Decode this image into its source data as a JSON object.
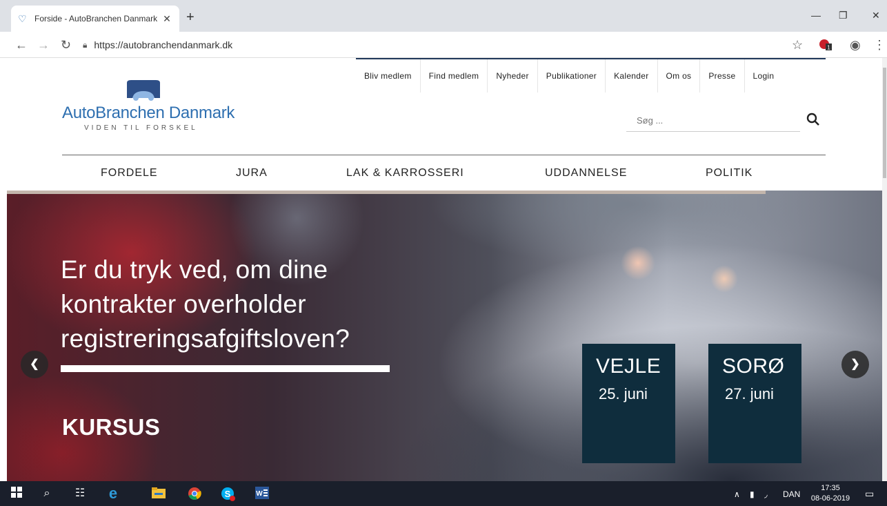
{
  "browser": {
    "tab_title": "Forside - AutoBranchen Danmark",
    "url": "https://autobranchendanmark.dk"
  },
  "site": {
    "brand_name": "AutoBranchen Danmark",
    "tagline": "VIDEN TIL FORSKEL",
    "top_nav": [
      "Bliv medlem",
      "Find medlem",
      "Nyheder",
      "Publikationer",
      "Kalender",
      "Om os",
      "Presse",
      "Login"
    ],
    "search_placeholder": "Søg ...",
    "main_nav": [
      "FORDELE",
      "JURA",
      "LAK & KARROSSERI",
      "UDDANNELSE",
      "POLITIK"
    ],
    "accent": "#2e6fb0",
    "card_color": "#0f2d3d"
  },
  "hero": {
    "headline": "Er du tryk ved, om dine kontrakter overholder registreringsafgiftsloven?",
    "label": "KURSUS",
    "cards": [
      {
        "city": "VEJLE",
        "date": "25. juni"
      },
      {
        "city": "SORØ",
        "date": "27. juni"
      }
    ]
  },
  "taskbar": {
    "language": "DAN",
    "time": "17:35",
    "date": "08-06-2019"
  },
  "icons": {
    "extension_badge": "1"
  }
}
